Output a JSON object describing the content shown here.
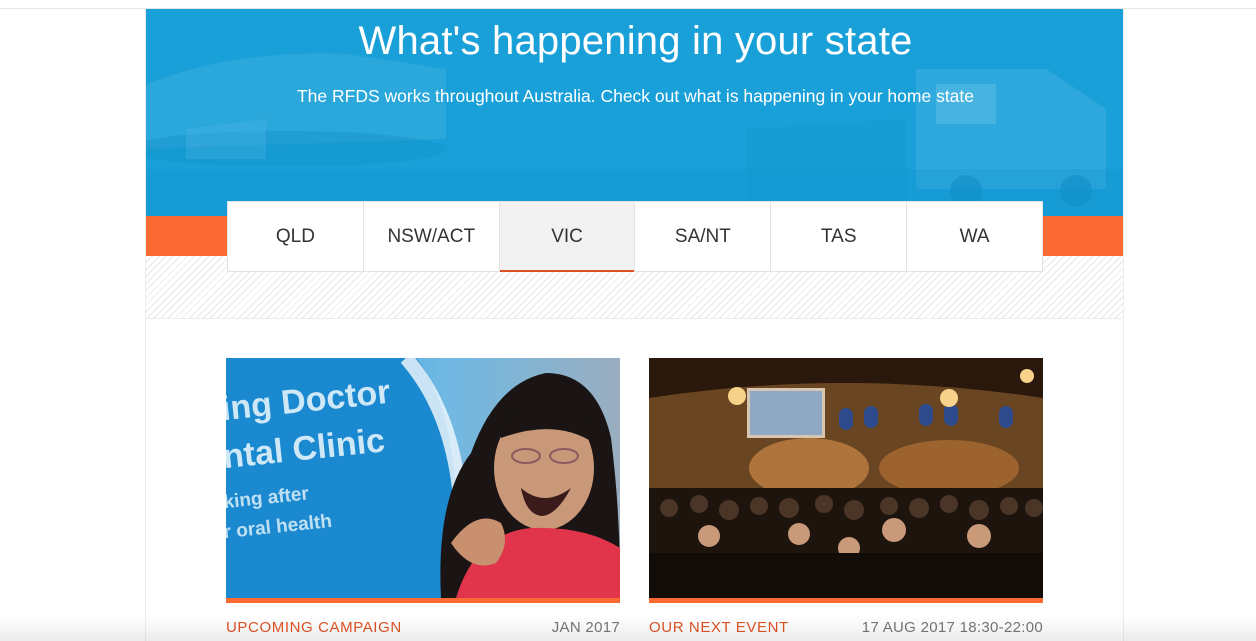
{
  "hero": {
    "title": "What's happening in your state",
    "subtitle": "The RFDS works throughout Australia. Check out what is happening in your home state"
  },
  "tabs": [
    {
      "label": "QLD",
      "active": false
    },
    {
      "label": "NSW/ACT",
      "active": false
    },
    {
      "label": "VIC",
      "active": true
    },
    {
      "label": "SA/NT",
      "active": false
    },
    {
      "label": "TAS",
      "active": false
    },
    {
      "label": "WA",
      "active": false
    }
  ],
  "cards": [
    {
      "type": "UPCOMING CAMPAIGN",
      "date": "JAN 2017",
      "image_text": [
        "ing Doctor",
        "ntal Clinic",
        "king after",
        "r oral health"
      ]
    },
    {
      "type": "OUR NEXT EVENT",
      "date": "17 AUG 2017 18:30-22:00"
    }
  ],
  "colors": {
    "hero_blue": "#1aa0d8",
    "accent_orange": "#fb6a33",
    "label_orange": "#e05425"
  }
}
